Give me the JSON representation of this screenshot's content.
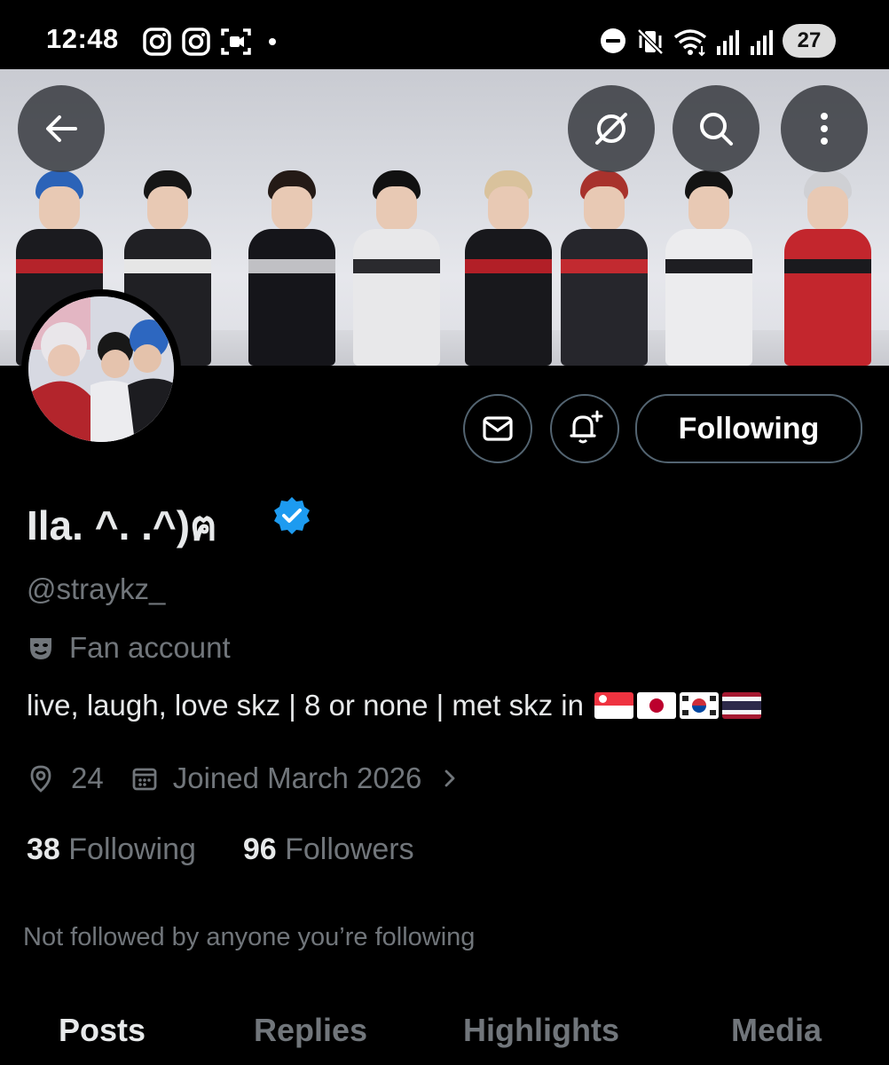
{
  "status_bar": {
    "time": "12:48",
    "battery": "27",
    "icons": [
      "instagram-icon",
      "instagram-icon",
      "screen-record-icon",
      "dot-icon",
      "dnd-icon",
      "mute-vibrate-icon",
      "wifi-icon",
      "signal-icon",
      "signal-icon"
    ]
  },
  "header": {
    "back_icon": "back-arrow-icon",
    "grok_icon": "grok-icon",
    "search_icon": "search-icon",
    "more_icon": "more-vertical-icon"
  },
  "actions": {
    "message_icon": "envelope-icon",
    "notify_icon": "bell-plus-icon",
    "following_label": "Following"
  },
  "profile": {
    "display_name": "Ila. ^. .^)ฅ",
    "verified_color": "#1d9bf0",
    "handle": "@straykz_",
    "category": "Fan account",
    "bio_text": "live, laugh, love skz | 8 or none | met skz in",
    "bio_flags": [
      "Singapore",
      "Japan",
      "South Korea",
      "Thailand"
    ],
    "location": "24",
    "joined": "Joined March 2026",
    "following_count": "38",
    "following_label": "Following",
    "followers_count": "96",
    "followers_label": "Followers",
    "followed_by": "Not followed by anyone you’re following"
  },
  "tabs": [
    {
      "label": "Posts",
      "active": true
    },
    {
      "label": "Replies",
      "active": false
    },
    {
      "label": "Highlights",
      "active": false
    },
    {
      "label": "Media",
      "active": false
    }
  ],
  "colors": {
    "background": "#000000",
    "primary_text": "#e7e9ea",
    "secondary_text": "#71767b",
    "border": "#536471",
    "accent": "#1d9bf0"
  }
}
